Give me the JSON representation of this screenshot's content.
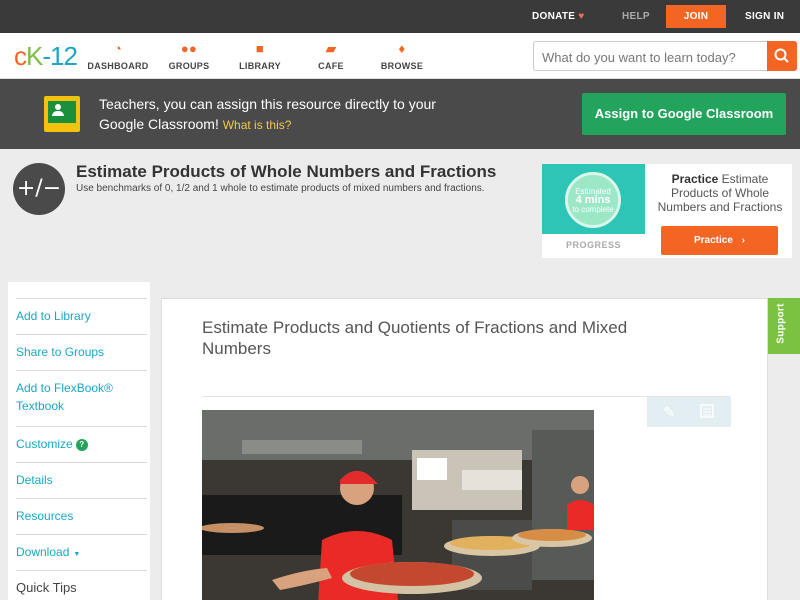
{
  "topbar": {
    "donate": "DONATE",
    "help": "HELP",
    "join": "JOIN",
    "signin": "SIGN IN"
  },
  "nav": {
    "logo": "CK-12",
    "items": [
      {
        "label": "DASHBOARD",
        "icon": "dashboard-icon"
      },
      {
        "label": "GROUPS",
        "icon": "groups-icon"
      },
      {
        "label": "LIBRARY",
        "icon": "library-icon"
      },
      {
        "label": "CAFE",
        "icon": "cafe-icon"
      },
      {
        "label": "BROWSE",
        "icon": "browse-icon"
      }
    ],
    "search_placeholder": "What do you want to learn today?"
  },
  "banner": {
    "text": "Teachers, you can assign this resource directly to your Google Classroom!",
    "what_link": "What is this?",
    "assign_button": "Assign to Google Classroom"
  },
  "concept": {
    "title": "Estimate Products of Whole Numbers and Fractions",
    "subtitle": "Use benchmarks of 0, 1/2 and 1 whole to estimate products of mixed numbers and fractions."
  },
  "practice_card": {
    "estimate_line1": "Estimated",
    "estimate_line2": "4 mins",
    "estimate_line3": "to complete",
    "progress_label": "PROGRESS",
    "practice_bold": "Practice",
    "practice_text": "Estimate Products of Whole Numbers and Fractions",
    "practice_button": "Practice"
  },
  "sidebar": {
    "items": [
      "Add to Library",
      "Share to Groups",
      "Add to FlexBook® Textbook",
      "Customize",
      "Details",
      "Resources",
      "Download"
    ],
    "quick_tips": "Quick Tips"
  },
  "content": {
    "lesson_title": "Estimate Products and Quotients of Fractions and Mixed Numbers"
  },
  "support_tab": "Support",
  "colors": {
    "accent": "#f26522",
    "link": "#1aa6c6",
    "green": "#22a45d",
    "support": "#7cc242"
  }
}
